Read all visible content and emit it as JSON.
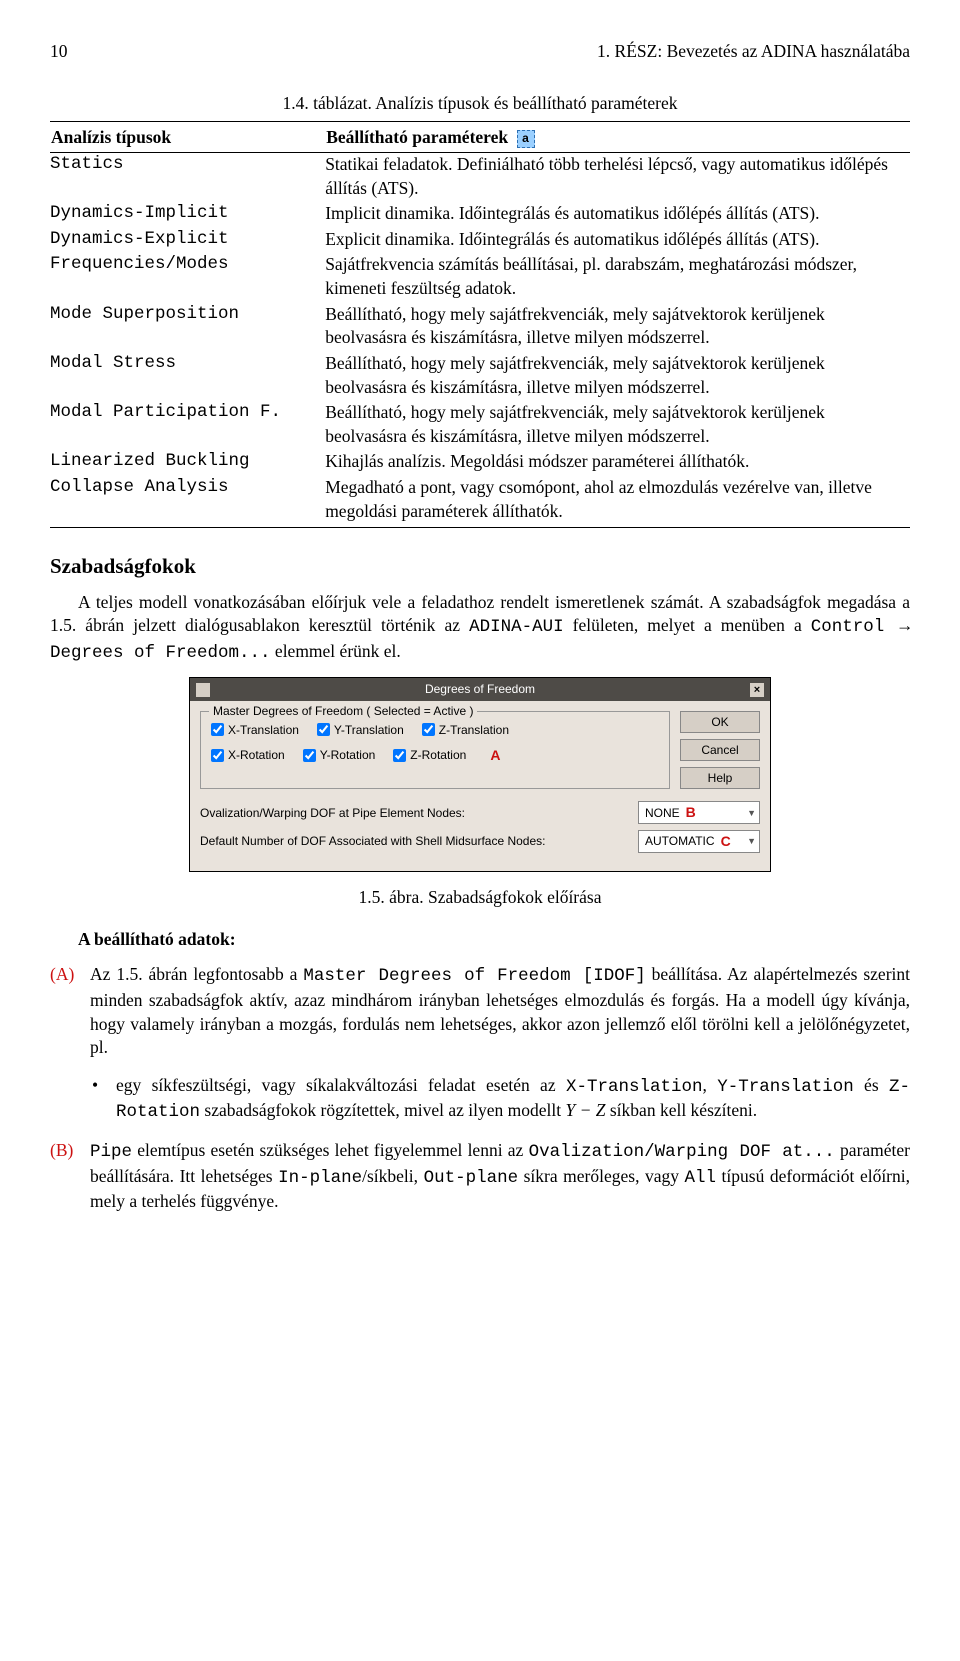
{
  "header": {
    "page_no": "10",
    "running": "1. RÉSZ: Bevezetés az ADINA használatába"
  },
  "table": {
    "caption": "1.4. táblázat. Analízis típusok és beállítható paraméterek",
    "col1_header": "Analízis típusok",
    "col2_header": "Beállítható paraméterek",
    "icon_letter": "a",
    "rows": [
      {
        "type": "Statics",
        "params": "Statikai feladatok. Definiálható több terhelési lépcső, vagy automatikus időlépés állítás (ATS)."
      },
      {
        "type": "Dynamics-Implicit",
        "params": "Implicit dinamika. Időintegrálás és automatikus időlépés állítás (ATS)."
      },
      {
        "type": "Dynamics-Explicit",
        "params": "Explicit dinamika. Időintegrálás és automatikus időlépés állítás (ATS)."
      },
      {
        "type": "Frequencies/Modes",
        "params": "Sajátfrekvencia számítás beállításai, pl. darabszám, meghatározási módszer, kimeneti feszültség adatok."
      },
      {
        "type": "Mode Superposition",
        "params": "Beállítható, hogy mely sajátfrekvenciák, mely sajátvektorok kerüljenek beolvasásra és kiszámításra, illetve milyen módszerrel."
      },
      {
        "type": "Modal Stress",
        "params": "Beállítható, hogy mely sajátfrekvenciák, mely sajátvektorok kerüljenek beolvasásra és kiszámításra, illetve milyen módszerrel."
      },
      {
        "type": "Modal Participation F.",
        "params": "Beállítható, hogy mely sajátfrekvenciák, mely sajátvektorok kerüljenek beolvasásra és kiszámításra, illetve milyen módszerrel."
      },
      {
        "type": "Linearized Buckling",
        "params": "Kihajlás analízis. Megoldási módszer paraméterei állíthatók."
      },
      {
        "type": "Collapse Analysis",
        "params": "Megadható a pont, vagy csomópont, ahol az elmozdulás vezérelve van, illetve megoldási paraméterek állíthatók."
      }
    ]
  },
  "section_heading": "Szabadságfokok",
  "para1_a": "A teljes modell vonatkozásában előírjuk vele a feladathoz rendelt ismeretlenek számát. A szabadságfok megadása a 1.5. ábrán jelzett dialógusablakon keresztül történik az ",
  "para1_code1": "ADINA-AUI",
  "para1_b": " felületen, melyet a menüben a ",
  "para1_code2": "Control → Degrees of Freedom...",
  "para1_c": " elemmel érünk el.",
  "dialog": {
    "title": "Degrees of Freedom",
    "fieldset_legend": "Master Degrees of Freedom ( Selected = Active )",
    "checks": [
      "X-Translation",
      "Y-Translation",
      "Z-Translation",
      "X-Rotation",
      "Y-Rotation",
      "Z-Rotation"
    ],
    "letterA": "A",
    "btn_ok": "OK",
    "btn_cancel": "Cancel",
    "btn_help": "Help",
    "row1_label": "Ovalization/Warping DOF at Pipe Element Nodes:",
    "row1_val": "NONE",
    "row1_letter": "B",
    "row2_label": "Default Number of DOF Associated with Shell Midsurface Nodes:",
    "row2_val": "AUTOMATIC",
    "row2_letter": "C"
  },
  "fig_caption": "1.5. ábra. Szabadságfokok előírása",
  "settable_heading": "A beállítható adatok:",
  "listA": {
    "marker": "(A)",
    "text_a": "Az 1.5. ábrán legfontosabb a ",
    "code1": "Master Degrees of Freedom [IDOF]",
    "text_b": " beállítása. Az alapértelmezés szerint minden szabadságfok aktív, azaz mindhárom irányban lehetséges elmozdulás és forgás. Ha a modell úgy kívánja, hogy valamely irányban a mozgás, fordulás nem lehetséges, akkor azon jellemző elől törölni kell a jelölőnégyzetet, pl."
  },
  "bullet": {
    "text_a": "egy síkfeszültségi, vagy síkalakváltozási feladat esetén az ",
    "code1": "X-Translation",
    "text_b": ", ",
    "code2": "Y-Translation",
    "text_c": " és ",
    "code3": "Z-Rotation",
    "text_d": " szabadságfokok rögzítettek, mivel az ilyen modellt ",
    "math": "Y − Z",
    "text_e": " síkban kell készíteni."
  },
  "listB": {
    "marker": "(B)",
    "code1": "Pipe",
    "text_a": " elemtípus esetén szükséges lehet figyelemmel lenni az ",
    "code2": "Ovalization/Warping DOF at...",
    "text_b": " paraméter beállítására. Itt lehetséges ",
    "code3": "In-plane",
    "text_c": "/síkbeli, ",
    "code4": "Out-plane",
    "text_d": " síkra merőleges, vagy ",
    "code5": "All",
    "text_e": " típusú deformációt előírni, mely a terhelés függvénye."
  }
}
